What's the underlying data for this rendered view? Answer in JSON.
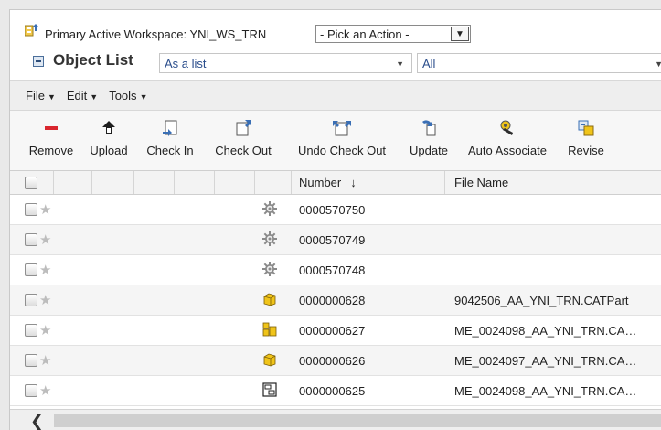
{
  "workspace": {
    "label": "Primary Active Workspace: YNI_WS_TRN",
    "action_select": "- Pick an Action -"
  },
  "object_list": {
    "title": "Object List",
    "view_select": "As a list",
    "filter_select": "All"
  },
  "menu": [
    {
      "label": "File"
    },
    {
      "label": "Edit"
    },
    {
      "label": "Tools"
    }
  ],
  "toolbar": [
    {
      "label": "Remove",
      "icon": "remove-icon"
    },
    {
      "label": "Upload",
      "icon": "upload-icon"
    },
    {
      "label": "Check In",
      "icon": "check-in-icon"
    },
    {
      "label": "Check Out",
      "icon": "check-out-icon"
    },
    {
      "label": "Undo Check Out",
      "icon": "undo-check-out-icon"
    },
    {
      "label": "Update",
      "icon": "update-icon"
    },
    {
      "label": "Auto Associate",
      "icon": "auto-associate-icon"
    },
    {
      "label": "Revise",
      "icon": "revise-icon"
    }
  ],
  "table": {
    "columns": {
      "number": "Number",
      "number_sort": "↓",
      "file_name": "File Name"
    },
    "rows": [
      {
        "type_icon": "gear-icon",
        "number": "0000570750",
        "file_name": ""
      },
      {
        "type_icon": "gear-icon",
        "number": "0000570749",
        "file_name": ""
      },
      {
        "type_icon": "gear-icon",
        "number": "0000570748",
        "file_name": ""
      },
      {
        "type_icon": "part-icon",
        "number": "0000000628",
        "file_name": "9042506_AA_YNI_TRN.CATPart"
      },
      {
        "type_icon": "assembly-icon",
        "number": "0000000627",
        "file_name": "ME_0024098_AA_YNI_TRN.CA…"
      },
      {
        "type_icon": "part-icon",
        "number": "0000000626",
        "file_name": "ME_0024097_AA_YNI_TRN.CA…"
      },
      {
        "type_icon": "drawing-icon",
        "number": "0000000625",
        "file_name": "ME_0024098_AA_YNI_TRN.CA…"
      }
    ]
  },
  "colors": {
    "link_blue": "#2b4e8c",
    "remove_red": "#d9262e",
    "icon_blue": "#3a6fb5",
    "part_yellow": "#f0c419"
  }
}
